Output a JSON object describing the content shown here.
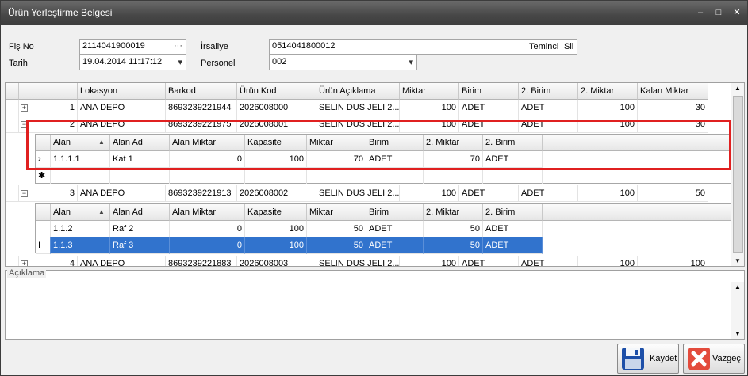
{
  "window": {
    "title": "Ürün Yerleştirme Belgesi",
    "min": "–",
    "max": "□",
    "close": "✕"
  },
  "form": {
    "fis_no_label": "Fiş No",
    "fis_no_value": "2114041900019",
    "fis_no_btn": "···",
    "tarih_label": "Tarih",
    "tarih_value": "19.04.2014 11:17:12",
    "irsaliye_label": "İrsaliye",
    "irsaliye_value": "0514041800012",
    "temin_btn": "Teminci",
    "sil_btn": "Sil",
    "personel_label": "Personel",
    "personel_value": "002"
  },
  "main_headers": [
    "",
    "",
    "Lokasyon",
    "Barkod",
    "Ürün Kod",
    "Ürün Açıklama",
    "Miktar",
    "Birim",
    "2. Birim",
    "2. Miktar",
    "Kalan Miktar"
  ],
  "sub_headers": [
    "",
    "Alan",
    "Alan Ad",
    "Alan Miktarı",
    "Kapasite",
    "Miktar",
    "Birim",
    "2. Miktar",
    "2. Birim"
  ],
  "rows": [
    {
      "no": "1",
      "lokasyon": "ANA DEPO",
      "barkod": "8693239221944",
      "kod": "2026008000",
      "aciklama": "SELIN DUS JELI 2...",
      "miktar": "100",
      "birim": "ADET",
      "birim2": "ADET",
      "miktar2": "100",
      "kalan": "30"
    },
    {
      "no": "2",
      "lokasyon": "ANA DEPO",
      "barkod": "8693239221975",
      "kod": "2026008001",
      "aciklama": "SELIN DUS JELI 2...",
      "miktar": "100",
      "birim": "ADET",
      "birim2": "ADET",
      "miktar2": "100",
      "kalan": "30"
    },
    {
      "no": "3",
      "lokasyon": "ANA DEPO",
      "barkod": "8693239221913",
      "kod": "2026008002",
      "aciklama": "SELIN DUS JELI 2...",
      "miktar": "100",
      "birim": "ADET",
      "birim2": "ADET",
      "miktar2": "100",
      "kalan": "50"
    },
    {
      "no": "4",
      "lokasyon": "ANA DEPO",
      "barkod": "8693239221883",
      "kod": "2026008003",
      "aciklama": "SELIN DUS JELI 2...",
      "miktar": "100",
      "birim": "ADET",
      "birim2": "ADET",
      "miktar2": "100",
      "kalan": "100"
    }
  ],
  "sub1": [
    {
      "alan": "1.1.1.1",
      "alan_ad": "Kat 1",
      "alan_miktari": "0",
      "kapasite": "100",
      "miktar": "70",
      "birim": "ADET",
      "miktar2": "70",
      "birim2": "ADET"
    }
  ],
  "sub2": [
    {
      "alan": "1.1.2",
      "alan_ad": "Raf 2",
      "alan_miktari": "0",
      "kapasite": "100",
      "miktar": "50",
      "birim": "ADET",
      "miktar2": "50",
      "birim2": "ADET"
    },
    {
      "alan": "1.1.3",
      "alan_ad": "Raf 3",
      "alan_miktari": "0",
      "kapasite": "100",
      "miktar": "50",
      "birim": "ADET",
      "miktar2": "50",
      "birim2": "ADET"
    }
  ],
  "aciklama_label": "Açıklama",
  "buttons": {
    "kaydet": "Kaydet",
    "vazgec": "Vazgeç"
  },
  "colors": {
    "selection": "#3173cd",
    "highlight": "#e02020",
    "titlebar": "#474747"
  }
}
